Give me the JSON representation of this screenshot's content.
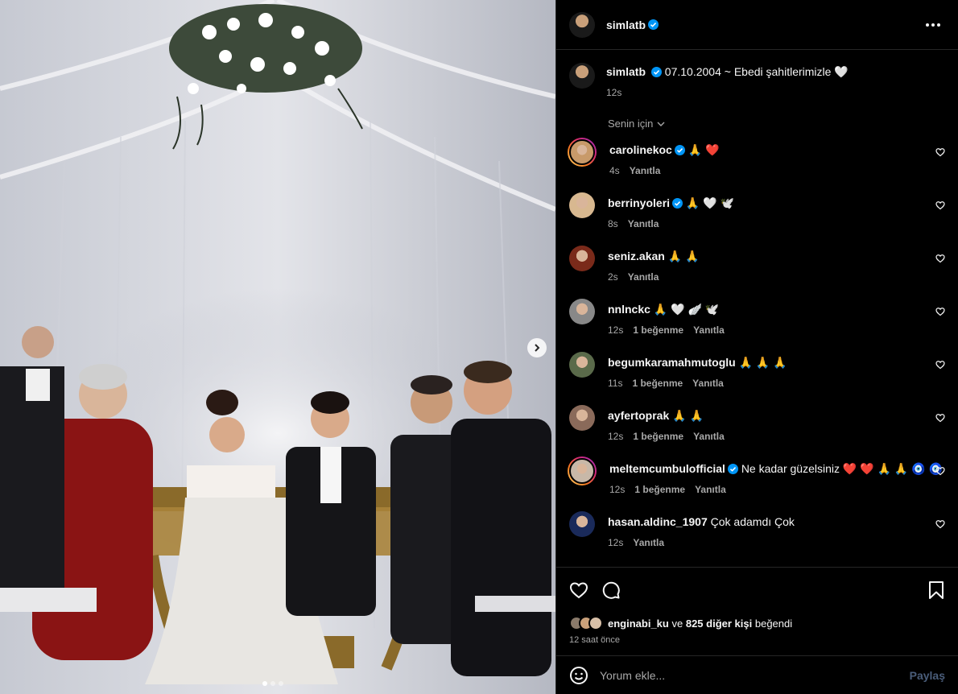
{
  "post": {
    "author": "simlatb",
    "caption": "07.10.2004 ~ Ebedi şahitlerimizle 🤍",
    "caption_time": "12s",
    "for_you_label": "Senin için",
    "photo_alt": "Wedding ceremony photo"
  },
  "comments": [
    {
      "user": "carolinekoc",
      "verified": true,
      "text": "🙏 ❤️",
      "time": "4s",
      "likes": "",
      "reply": "Yanıtla",
      "color": "#c89a6a",
      "ring": true
    },
    {
      "user": "berrinyoleri",
      "verified": true,
      "text": "🙏 🤍 🕊️",
      "time": "8s",
      "likes": "",
      "reply": "Yanıtla",
      "color": "#d8b890",
      "ring": false
    },
    {
      "user": "seniz.akan",
      "verified": false,
      "text": "🙏 🙏",
      "time": "2s",
      "likes": "",
      "reply": "Yanıtla",
      "color": "#7a2a1a",
      "ring": false
    },
    {
      "user": "nnlnckc",
      "verified": false,
      "text": "🙏 🤍 🪽 🕊️",
      "time": "12s",
      "likes": "1 beğenme",
      "reply": "Yanıtla",
      "color": "#888888",
      "ring": false
    },
    {
      "user": "begumkaramahmutoglu",
      "verified": false,
      "text": "🙏 🙏 🙏",
      "time": "11s",
      "likes": "1 beğenme",
      "reply": "Yanıtla",
      "color": "#5a6a4a",
      "ring": false
    },
    {
      "user": "ayfertoprak",
      "verified": false,
      "text": "🙏 🙏",
      "time": "12s",
      "likes": "1 beğenme",
      "reply": "Yanıtla",
      "color": "#8a6a5a",
      "ring": false
    },
    {
      "user": "meltemcumbulofficial",
      "verified": true,
      "text": "Ne kadar güzelsiniz ❤️ ❤️ 🙏 🙏 🧿 🧿",
      "time": "12s",
      "likes": "1 beğenme",
      "reply": "Yanıtla",
      "color": "#c8b8a8",
      "ring": true
    },
    {
      "user": "hasan.aldinc_1907",
      "verified": false,
      "text": "Çok adamdı Çok",
      "time": "12s",
      "likes": "",
      "reply": "Yanıtla",
      "color": "#1a2a5a",
      "ring": false
    }
  ],
  "likes": {
    "first_user": "enginabi_ku",
    "connector": "ve",
    "others": "825 diğer kişi",
    "suffix": "beğendi",
    "time_ago": "12 saat önce"
  },
  "composer": {
    "placeholder": "Yorum ekle...",
    "post_label": "Paylaş"
  },
  "colors": {
    "background": "#000000",
    "verified": "#0095f6",
    "muted_text": "#a8a8a8"
  }
}
